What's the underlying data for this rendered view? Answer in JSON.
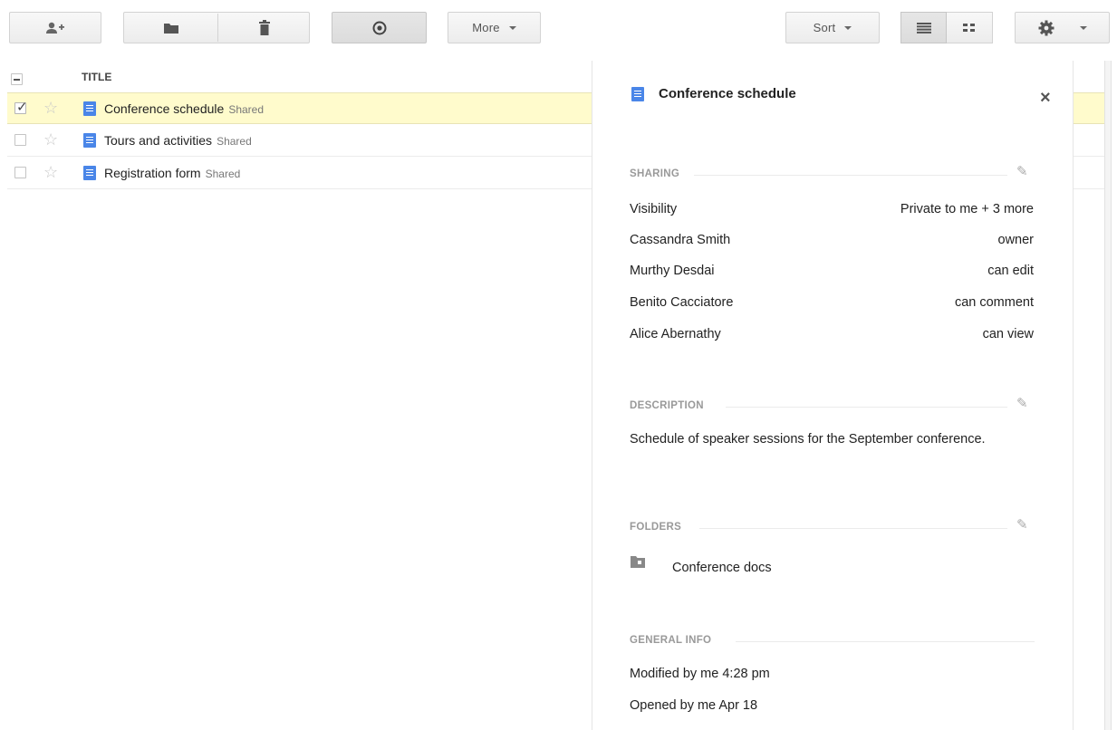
{
  "toolbar": {
    "more_label": "More",
    "sort_label": "Sort"
  },
  "list": {
    "title_header": "TITLE",
    "rows": [
      {
        "title": "Conference schedule",
        "badge": "Shared",
        "checked": true
      },
      {
        "title": "Tours and activities",
        "badge": "Shared",
        "checked": false
      },
      {
        "title": "Registration form",
        "badge": "Shared",
        "checked": false
      }
    ]
  },
  "details": {
    "title": "Conference schedule",
    "close_glyph": "×",
    "sharing": {
      "label": "SHARING",
      "rows": [
        {
          "name": "Visibility",
          "value": "Private to me + 3 more"
        },
        {
          "name": "Cassandra Smith",
          "value": "owner"
        },
        {
          "name": "Murthy Desdai",
          "value": "can edit"
        },
        {
          "name": "Benito Cacciatore",
          "value": "can comment"
        },
        {
          "name": "Alice Abernathy",
          "value": "can view"
        }
      ]
    },
    "description": {
      "label": "DESCRIPTION",
      "text": "Schedule of speaker sessions for the September conference."
    },
    "folders": {
      "label": "FOLDERS",
      "items": [
        "Conference docs"
      ]
    },
    "general_info": {
      "label": "GENERAL INFO",
      "modified": "Modified by me 4:28 pm",
      "opened": "Opened by me Apr 18"
    }
  },
  "colors": {
    "selected_row": "#fffbcc",
    "doc_icon": "#4a86e8"
  }
}
